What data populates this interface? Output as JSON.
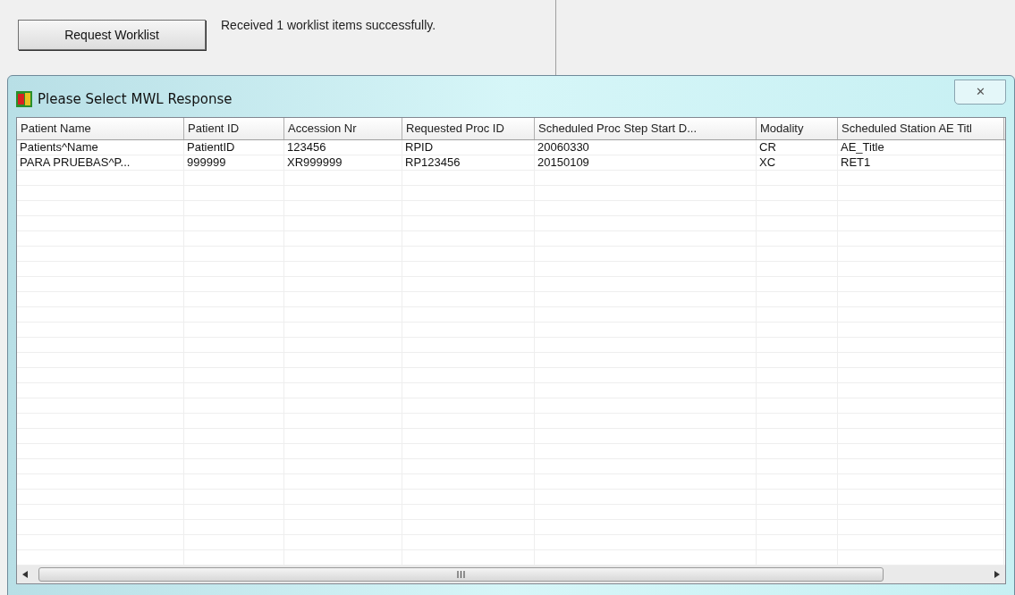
{
  "toolbar": {
    "button": "Request Worklist",
    "message": "Received 1 worklist items successfully."
  },
  "dialog": {
    "title": "Please Select MWL Response",
    "close": "✕",
    "table": {
      "columns": [
        "Patient Name",
        "Patient ID",
        "Accession Nr",
        "Requested Proc ID",
        "Scheduled Proc Step Start D...",
        "Modality",
        "Scheduled Station AE Titl"
      ],
      "rows": [
        {
          "selected": false,
          "cells": [
            "Patients^Name",
            "PatientID",
            "123456",
            "RPID",
            "20060330",
            "CR",
            "AE_Title"
          ]
        },
        {
          "selected": false,
          "cells": [
            "PARA PRUEBAS^P...",
            "999999",
            "XR999999",
            "RP123456",
            "20150109",
            "XC",
            "RET1"
          ]
        }
      ]
    }
  }
}
